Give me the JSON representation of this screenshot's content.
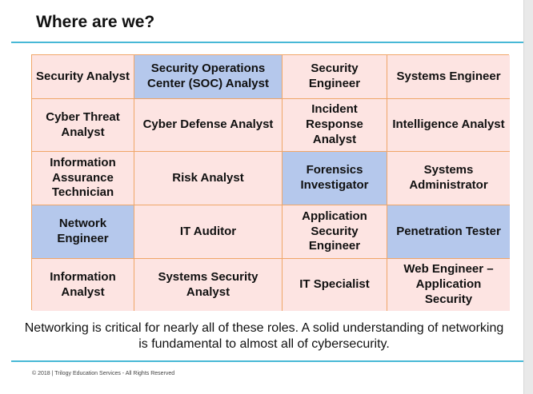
{
  "slide": {
    "title": "Where are we?",
    "roles": [
      [
        {
          "label": "Security Analyst",
          "highlighted": false
        },
        {
          "label": "Security Operations Center (SOC) Analyst",
          "highlighted": true
        },
        {
          "label": "Security Engineer",
          "highlighted": false
        },
        {
          "label": "Systems Engineer",
          "highlighted": false
        }
      ],
      [
        {
          "label": "Cyber Threat Analyst",
          "highlighted": false
        },
        {
          "label": "Cyber Defense Analyst",
          "highlighted": false
        },
        {
          "label": "Incident Response Analyst",
          "highlighted": false
        },
        {
          "label": "Intelligence Analyst",
          "highlighted": false
        }
      ],
      [
        {
          "label": "Information Assurance Technician",
          "highlighted": false
        },
        {
          "label": "Risk Analyst",
          "highlighted": false
        },
        {
          "label": "Forensics Investigator",
          "highlighted": true
        },
        {
          "label": "Systems Administrator",
          "highlighted": false
        }
      ],
      [
        {
          "label": "Network Engineer",
          "highlighted": true
        },
        {
          "label": "IT Auditor",
          "highlighted": false
        },
        {
          "label": "Application Security Engineer",
          "highlighted": false
        },
        {
          "label": "Penetration Tester",
          "highlighted": true
        }
      ],
      [
        {
          "label": "Information Analyst",
          "highlighted": false
        },
        {
          "label": "Systems Security Analyst",
          "highlighted": false
        },
        {
          "label": "IT Specialist",
          "highlighted": false
        },
        {
          "label": "Web Engineer – Application Security",
          "highlighted": false
        }
      ]
    ],
    "caption": "Networking is critical for nearly all of these roles. A solid understanding of networking is fundamental to almost all of cybersecurity.",
    "footer": "© 2018 | Trilogy Education Services - All Rights Reserved"
  },
  "colors": {
    "cell_background": "#fde4e2",
    "highlight_background": "#b5c8ec",
    "grid_border": "#f0a668",
    "rule": "#47b8d6"
  }
}
